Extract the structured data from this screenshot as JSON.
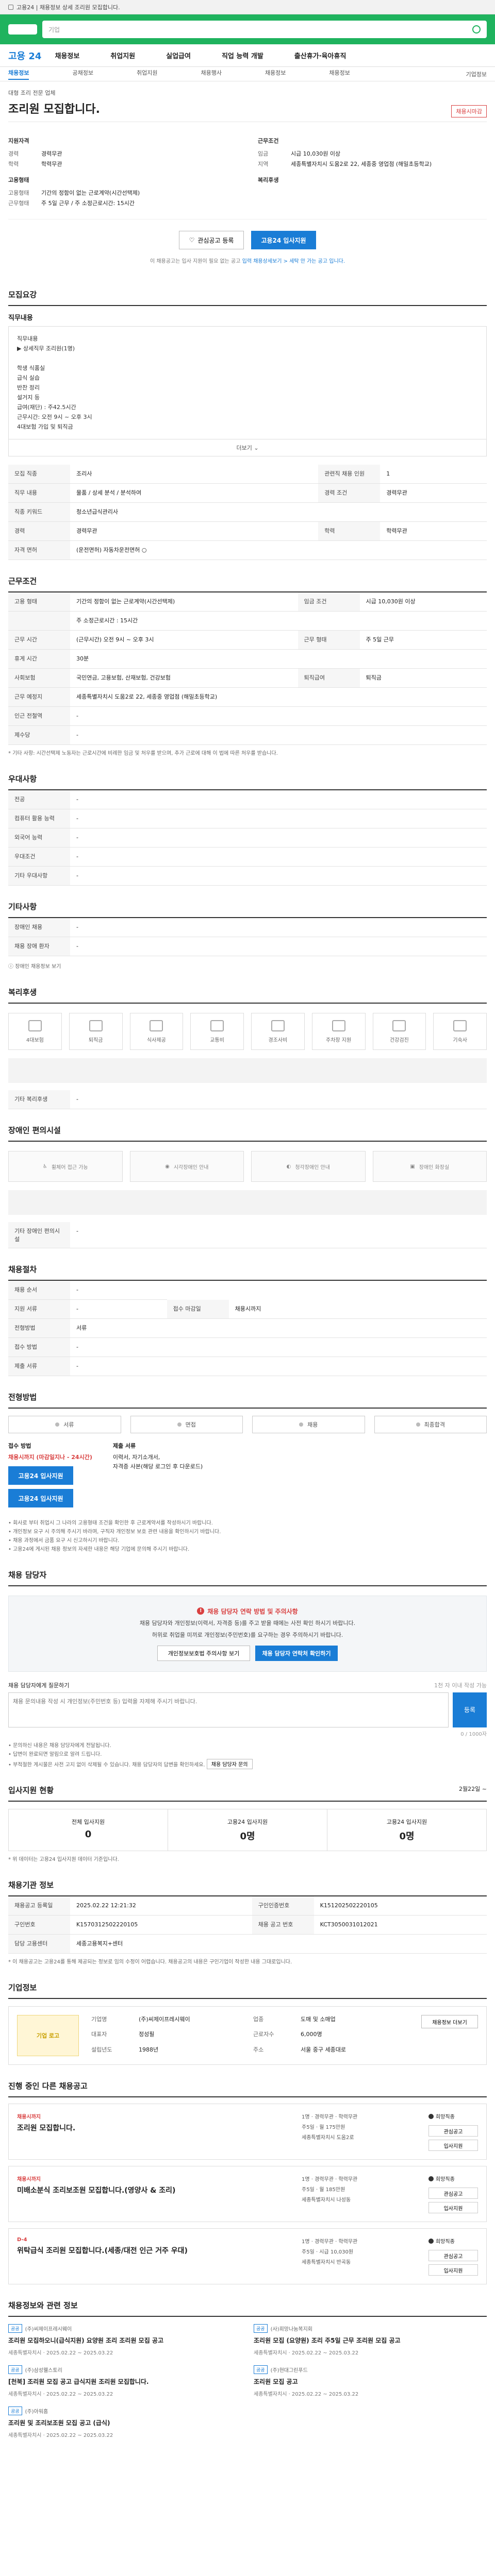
{
  "topstrip": {
    "url_text": "고용24 | 채용정보 상세 조리원 모집합니다."
  },
  "header": {
    "search_placeholder": "기업"
  },
  "gnb": {
    "logo": "고용 24",
    "menu": [
      "채용정보",
      "취업지원",
      "실업급여",
      "직업 능력 개발",
      "출산휴가·육아휴직"
    ]
  },
  "subnav": {
    "items": [
      "채용정보",
      "공채정보",
      "취업지원",
      "채용행사",
      "채용정보",
      "채용정보",
      "기업정보"
    ],
    "right": "기업정보"
  },
  "job": {
    "company": "대형 조리 전문 업체",
    "title": "조리원 모집합니다.",
    "hire_badge": "채용시마감"
  },
  "overview": {
    "left_title": "지원자격",
    "left_rows": [
      {
        "k": "경력",
        "v": "경력무관"
      },
      {
        "k": "학력",
        "v": "학력무관"
      }
    ],
    "left_title2": "고용형태",
    "left_rows2": [
      {
        "k": "고용형태",
        "v": "기간의 정함이 없는 근로계약(시간선택제)"
      },
      {
        "k": "근무형태",
        "v": "주 5일 근무 / 주 소정근로시간: 15시간"
      }
    ],
    "right_title": "근무조건",
    "right_rows": [
      {
        "k": "임금",
        "v": "시급 10,030원 이상"
      },
      {
        "k": "지역",
        "v": "세종특별자치시 도움2로 22, 세종중 영업점 (해밀초등학교)"
      }
    ],
    "right_title2": "복리후생",
    "right_rows2": []
  },
  "apply": {
    "scrap": "관심공고 등록",
    "apply_btn": "고용24 입사지원",
    "note_a": "이 채용공고는 입사 지원이 필요 없는 공고",
    "note_link": "입력 채용상세보기 > 세탁 안 가는 공고 입니다."
  },
  "duty": {
    "section": "모집요강",
    "sub": "직무내용",
    "text": "직무내용\n▶ 상세직무 조리원(1명)\n\n학생 식품실\n급식 실습\n반찬 정리\n설거지 등\n급여(재단) : 주42.5시간\n근무시간: 오전 9시 ~ 오후 3시\n4대보험 가입 및 퇴직금",
    "more": "더보기"
  },
  "recruit_table": [
    {
      "k": "모집 직종",
      "v": "조리사",
      "k2": "관련직 채용 인원",
      "v2": "1"
    },
    {
      "k": "직무 내용",
      "v": "물품 / 상세 분석 / 분석하여",
      "k2": "경력 조건",
      "v2": "경력무관"
    },
    {
      "k": "직종 키워드",
      "v": "청소년급식관리사",
      "k2": "",
      "v2": ""
    },
    {
      "k": "경력",
      "v": "경력무관",
      "k2": "학력",
      "v2": "학력무관"
    },
    {
      "k": "자격 면허",
      "v": "(운전면허) 자동차운전면허 ○",
      "k2": "",
      "v2": ""
    }
  ],
  "work_section": "근무조건",
  "work_table": [
    {
      "k": "고용 형태",
      "v": "기간의 정함이 없는 근로계약(시간선택제)",
      "k2": "임금 조건",
      "v2": "시급 10,030원 이상"
    },
    {
      "k": "",
      "v": "주 소정근로시간 : 15시간",
      "k2": "",
      "v2": ""
    },
    {
      "k": "근무 시간",
      "v": "(근무시간) 오전 9시 ~ 오후 3시",
      "k2": "근무 형태",
      "v2": "주 5일 근무"
    },
    {
      "k": "휴게 시간",
      "v": "30분",
      "k2": "",
      "v2": ""
    },
    {
      "k": "사회보험",
      "v": "국민연금, 고용보험, 산재보험, 건강보험",
      "k2": "퇴직급여",
      "v2": "퇴직금"
    },
    {
      "k": "근무 예정지",
      "v": "세종특별자치시 도움2로 22, 세종중 영업점 (해밀초등학교)",
      "k2": "",
      "v2": ""
    },
    {
      "k": "인근 전철역",
      "v": "-",
      "k2": "",
      "v2": ""
    },
    {
      "k": "제수당",
      "v": "-",
      "k2": "",
      "v2": ""
    }
  ],
  "work_note": "* 기타 사항: 시간선택제 노동자는 근로시간에 비례한 임금 및 처우를 받으며, 추가 근로에 대해 이 법에 따른 처우를 받습니다.",
  "prefer_section": "우대사항",
  "prefer_table": [
    {
      "k": "전공",
      "v": "-"
    },
    {
      "k": "컴퓨터 활용 능력",
      "v": "-"
    },
    {
      "k": "외국어 능력",
      "v": "-"
    },
    {
      "k": "우대조건",
      "v": "-"
    },
    {
      "k": "기타 우대사항",
      "v": "-"
    }
  ],
  "etc_section": "기타사항",
  "etc_table": [
    {
      "k": "장애인 채용",
      "v": "-"
    },
    {
      "k": "채용 장애 환자",
      "v": "-"
    }
  ],
  "etc_link": "장애인 채용정보 보기",
  "benefit": {
    "section": "복리후생",
    "items": [
      "4대보험",
      "퇴직금",
      "식사제공",
      "교통비",
      "경조사비",
      "주차장 지원",
      "건강검진",
      "기숙사"
    ],
    "other_label": "기타 복리후생",
    "other_value": "-",
    "disability_section": "장애인 편의시설",
    "disability_items": [
      "휠체어 접근 가능",
      "시각장애인 안내",
      "청각장애인 안내",
      "장애인 화장실"
    ],
    "disability_other": "기타 장애인 편의시설",
    "disability_other_v": "-"
  },
  "process": {
    "section": "채용절차",
    "rows": [
      {
        "k": "채용 순서",
        "v": "-"
      },
      {
        "k": "지원 서류",
        "v": "-"
      },
      {
        "k": "전형방법",
        "v": "서류"
      },
      {
        "k": "접수 방법",
        "v": "-"
      },
      {
        "k": "제출 서류",
        "v": "-"
      }
    ],
    "extra_k": "접수 마감일",
    "extra_v": "채용시까지",
    "steps_section": "전형방법",
    "steps": [
      "서류",
      "면접",
      "채용",
      "최종합격"
    ],
    "method_title": "접수 방법",
    "method_red": "채용시까지 (마감일지나 - 24시간)",
    "method_btn1": "고용24 입사지원",
    "method_btn2": "고용24 입사지원",
    "method_title2": "제출 서류",
    "method_text2": "이력서, 자기소개서,\n자격증 사본(해당 로그인 후 다운로드)",
    "notes": [
      "• 회사로 부터 취업시 그 나라의 고용형태 조건을 확인한 후 근로계약서를 작성하시기 바랍니다.",
      "• 개인정보 요구 시 주의해 주시기 바라며, 구직자 개인정보 보호 관련 내용을 확인하시기 바랍니다.",
      "• 채용 과정에서 금품 요구 시 신고하시기 바랍니다.",
      "• 고용24에 게시된 채용 정보의 자세한 내용은 해당 기업에 문의해 주시기 바랍니다."
    ]
  },
  "consult": {
    "section": "채용 담당자",
    "warn": "채용 담당자 연락 방법 및 주의사항",
    "p1": "채용 담당자와 개인정보(이력서, 자격증 등)를 주고 받을 때에는 사전 확인 하시기 바랍니다.",
    "p2": "허위로 취업을 미끼로 개인정보(주민번호)를 요구하는 경우 주의하시기 바랍니다.",
    "btn1": "개인정보보호법 주의사항 보기",
    "btn2": "채용 담당자 연락처 확인하기",
    "inquiry_title": "채용 담당자에게 질문하기",
    "inquiry_right": "1천 자 이내 작성 가능",
    "inquiry_placeholder": "채용 문의내용 작성 시 개인정보(주민번호 등) 입력을 자제해 주시기 바랍니다.",
    "inquiry_btn": "등록",
    "counter": "0 / 1000자",
    "notes": [
      "• 문의하신 내용은 채용 담당자에게 전달됩니다.",
      "• 답변이 완료되면 알림으로 알려 드립니다.",
      "• 부적절한 게시물은 사전 고지 없이 삭제될 수 있습니다. 채용 담당자의 답변을 확인하세요."
    ],
    "notes_btn": "채용 담당자 문의"
  },
  "stats": {
    "section": "입사지원 현황",
    "right": "2월22일 ~",
    "items": [
      {
        "label": "전체 입사지원",
        "n": "0"
      },
      {
        "label": "고용24 입사지원",
        "n": "0명"
      },
      {
        "label": "고용24 입사지원",
        "n": "0명"
      }
    ],
    "note": "* 위 데이터는 고용24 입사지원 데이터 기준입니다."
  },
  "meta": {
    "section": "채용기관 정보",
    "rows": [
      {
        "k": "채용공고 등록일",
        "v": "2025.02.22 12:21:32",
        "k2": "구인인증번호",
        "v2": "K151202502220105"
      },
      {
        "k": "구인번호",
        "v": "K1570312502220105",
        "k2": "채용 공고 번호",
        "v2": "KCT3050031012021"
      },
      {
        "k": "담당 고용센터",
        "v": "세종고용복지+센터",
        "k2": "",
        "v2": ""
      }
    ],
    "notes": "* 이 채용공고는 고용24를 통해 제공되는 정보로 임의 수정이 어렵습니다. 채용공고의 내용은 구인기업이 작성한 내용 그대로입니다."
  },
  "company": {
    "section": "기업정보",
    "logo": "기업 로고",
    "info": [
      {
        "k": "기업명",
        "v": "(주)씨제이프레시웨이",
        "k2": "업종",
        "v2": "도매 및 소매업"
      },
      {
        "k": "대표자",
        "v": "정성필",
        "k2": "근로자수",
        "v2": "6,000명"
      },
      {
        "k": "설립년도",
        "v": "1988년",
        "k2": "주소",
        "v2": "서울 중구 세종대로"
      }
    ],
    "btn": "채용정보 더보기"
  },
  "others": {
    "section": "진행 중인 다른 채용공고",
    "items": [
      {
        "tag": "채용시까지",
        "title": "조리원 모집합니다.",
        "meta": [
          "1명 · 경력무관 · 학력무관",
          "주5일 · 월 175만원",
          "세종특별자치시 도움2로"
        ],
        "btn1": "관심공고",
        "btn2": "입사지원"
      },
      {
        "tag": "채용시까지",
        "title": "미배소분식 조리보조원 모집합니다.(영양사 & 조리)",
        "meta": [
          "1명 · 경력무관 · 학력무관",
          "주5일 · 월 185만원",
          "세종특별자치시 나성동"
        ],
        "btn1": "관심공고",
        "btn2": "입사지원"
      },
      {
        "tag": "D-4",
        "title": "위탁급식 조리원 모집합니다.(세종/대전 인근 거주 우대)",
        "meta": [
          "1명 · 경력무관 · 학력무관",
          "주5일 · 시급 10,030원",
          "세종특별자치시 반곡동"
        ],
        "btn1": "관심공고",
        "btn2": "입사지원"
      }
    ],
    "hope": "희망직종"
  },
  "recommend": {
    "section": "채용정보와 관련 정보",
    "items": [
      {
        "cname": "(주)씨제이프레시웨이",
        "tag": "공공",
        "title": "조리원 모집하오니(급식지원) 요양원 조리 조리원 모집 공고",
        "meta": "세종특별자치시 · 2025.02.22 ~ 2025.03.22"
      },
      {
        "cname": "(사)희망나눔복지회",
        "tag": "공공",
        "title": "조리원 모집 (요양원) 조리 주5일 근무 조리원 모집 공고",
        "meta": "세종특별자치시 · 2025.02.22 ~ 2025.03.22"
      },
      {
        "cname": "(주)삼성웰스토리",
        "tag": "공공",
        "title": "[천북] 조리원 모집 공고 급식지원 조리원 모집합니다.",
        "meta": "세종특별자치시 · 2025.02.22 ~ 2025.03.22"
      },
      {
        "cname": "(주)현대그린푸드",
        "tag": "공공",
        "title": "조리원 모집 공고",
        "meta": "세종특별자치시 · 2025.02.22 ~ 2025.03.22"
      },
      {
        "cname": "(주)아워홈",
        "tag": "공공",
        "title": "조리원 및 조리보조원 모집 공고 (급식)",
        "meta": "세종특별자치시 · 2025.02.22 ~ 2025.03.22"
      }
    ]
  }
}
